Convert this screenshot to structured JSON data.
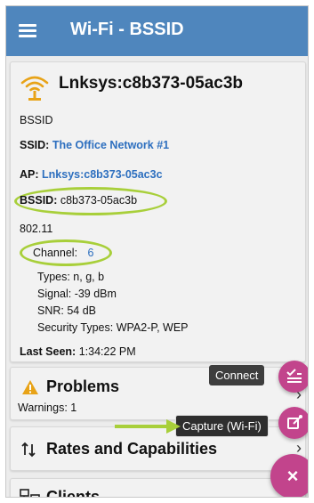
{
  "appbar": {
    "title": "Wi-Fi - BSSID"
  },
  "device": {
    "title": "Lnksys:c8b373-05ac3b",
    "type_label": "BSSID",
    "ssid_label": "SSID:",
    "ssid_value": "The Office Network #1",
    "ap_label": "AP:",
    "ap_value": "Lnksys:c8b373-05ac3c",
    "bssid_label": "BSSID:",
    "bssid_value": "c8b373-05ac3b",
    "standard": "802.11",
    "channel_label": "Channel:",
    "channel_value": "6",
    "types": "Types:  n, g, b",
    "signal": "Signal:  -39 dBm",
    "snr": "SNR:  54 dB",
    "security": "Security Types:  WPA2-P, WEP",
    "last_seen_label": "Last Seen:",
    "last_seen_value": "1:34:22 PM"
  },
  "problems": {
    "title": "Problems",
    "warnings": "Warnings: 1"
  },
  "rates": {
    "title": "Rates and Capabilities"
  },
  "clients": {
    "title": "Clients"
  },
  "fab_menu": {
    "connect_label": "Connect",
    "capture_label": "Capture (Wi-Fi)",
    "close_glyph": "×"
  },
  "colors": {
    "appbar": "#4f86bd",
    "link": "#2d6fbf",
    "fab": "#c2448c",
    "highlight": "#a8cf3a",
    "warning": "#e8a317"
  }
}
